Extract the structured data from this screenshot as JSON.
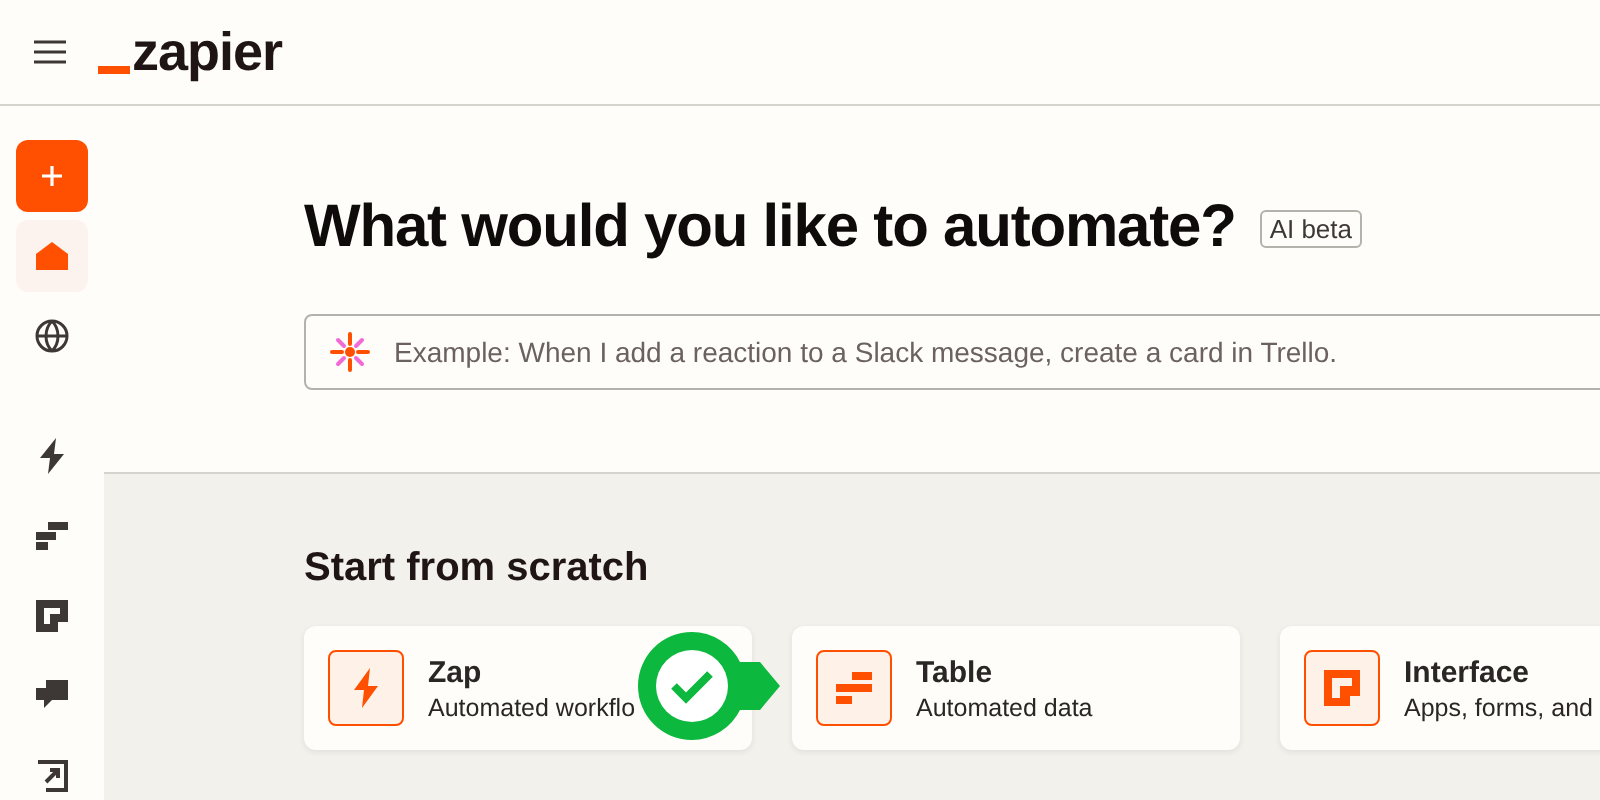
{
  "header": {
    "logo": "zapier"
  },
  "sidebar": {
    "items": [
      {
        "kind": "create",
        "selected": false
      },
      {
        "kind": "home",
        "selected": true
      },
      {
        "kind": "globe",
        "selected": false
      },
      {
        "kind": "divider"
      },
      {
        "kind": "zap",
        "selected": false
      },
      {
        "kind": "table",
        "selected": false
      },
      {
        "kind": "interface",
        "selected": false
      },
      {
        "kind": "chat",
        "selected": false
      },
      {
        "kind": "canvas",
        "selected": false
      }
    ]
  },
  "hero": {
    "title": "What would you like to automate?",
    "badge": "AI beta",
    "prompt": {
      "placeholder": "Example: When I add a reaction to a Slack message, create a card in Trello."
    }
  },
  "section": {
    "title": "Start from scratch",
    "cards": [
      {
        "kind": "zap",
        "title": "Zap",
        "subtitle": "Automated workflo"
      },
      {
        "kind": "table",
        "title": "Table",
        "subtitle": "Automated data"
      },
      {
        "kind": "interface",
        "title": "Interface",
        "subtitle": "Apps, forms, and"
      }
    ]
  },
  "marker": {
    "kind": "check"
  }
}
